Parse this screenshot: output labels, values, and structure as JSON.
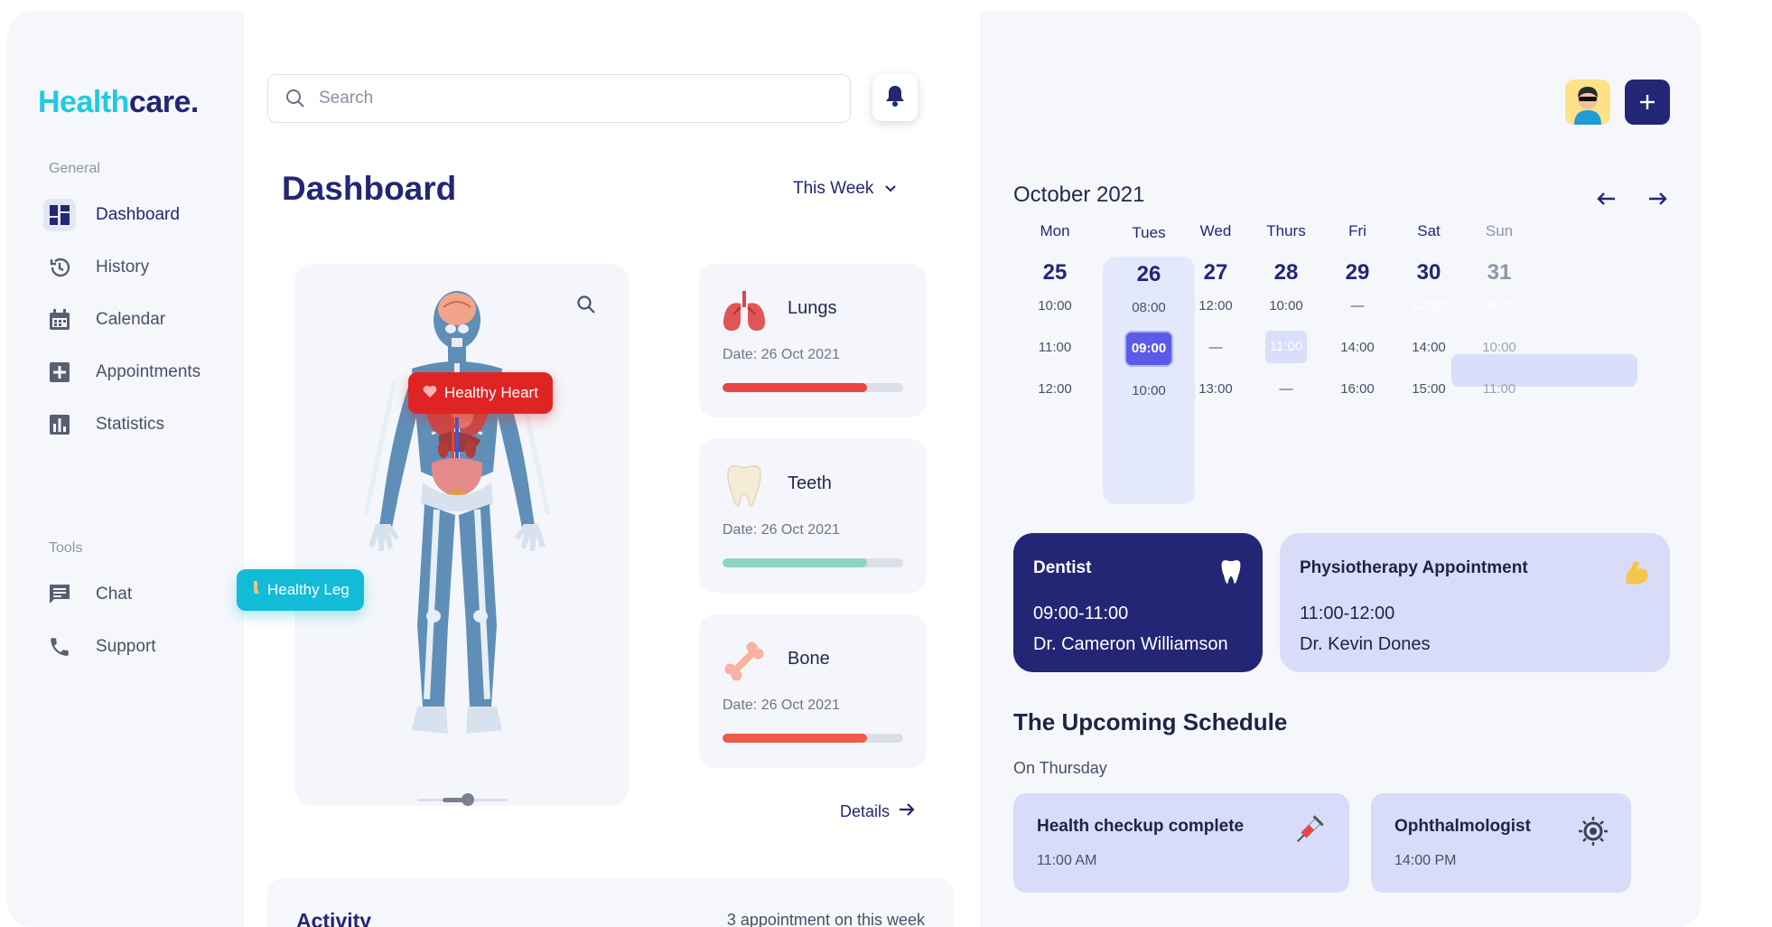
{
  "sidebar": {
    "logo_part1": "Health",
    "logo_part2": "care.",
    "general_label": "General",
    "tools_label": "Tools",
    "items": [
      {
        "label": "Dashboard"
      },
      {
        "label": "History"
      },
      {
        "label": "Calendar"
      },
      {
        "label": "Appointments"
      },
      {
        "label": "Statistics"
      },
      {
        "label": "Chat"
      },
      {
        "label": "Support"
      }
    ]
  },
  "header": {
    "search_placeholder": "Search"
  },
  "main": {
    "title": "Dashboard",
    "period": "This Week",
    "badges": {
      "heart": "Healthy Heart",
      "leg": "Healthy Leg"
    },
    "slider_value": 0.5,
    "organs": [
      {
        "name": "Lungs",
        "date": "Date: 26 Oct 2021",
        "progress": 0.8,
        "color": "#e84646"
      },
      {
        "name": "Teeth",
        "date": "Date: 26 Oct 2021",
        "progress": 0.8,
        "color": "#8fd3c3"
      },
      {
        "name": "Bone",
        "date": "Date: 26 Oct 2021",
        "progress": 0.8,
        "color": "#f05a4a"
      }
    ],
    "details_label": "Details",
    "activity": {
      "title": "Activity",
      "subtitle": "3 appointment on this week"
    }
  },
  "calendar": {
    "month": "October 2021",
    "days": [
      {
        "name": "Mon",
        "date": "25",
        "slots": [
          "10:00",
          "11:00",
          "12:00"
        ]
      },
      {
        "name": "Tues",
        "date": "26",
        "slots": [
          "08:00",
          "09:00",
          "10:00"
        ]
      },
      {
        "name": "Wed",
        "date": "27",
        "slots": [
          "12:00",
          "—",
          "13:00"
        ]
      },
      {
        "name": "Thurs",
        "date": "28",
        "slots": [
          "10:00",
          "11:00",
          "—"
        ]
      },
      {
        "name": "Fri",
        "date": "29",
        "slots": [
          "—",
          "14:00",
          "16:00"
        ]
      },
      {
        "name": "Sat",
        "date": "30",
        "slots": [
          "12:00",
          "14:00",
          "15:00"
        ]
      },
      {
        "name": "Sun",
        "date": "31",
        "slots": [
          "09:00",
          "10:00",
          "11:00"
        ]
      }
    ]
  },
  "appointments": [
    {
      "title": "Dentist",
      "time": "09:00-11:00",
      "doctor": "Dr. Cameron Williamson"
    },
    {
      "title": "Physiotherapy Appointment",
      "time": "11:00-12:00",
      "doctor": "Dr. Kevin Dones"
    }
  ],
  "upcoming": {
    "title": "The Upcoming Schedule",
    "subtitle": "On Thursday",
    "items": [
      {
        "title": "Health checkup complete",
        "time": "11:00 AM",
        "icon": "syringe-icon"
      },
      {
        "title": "Ophthalmologist",
        "time": "14:00 PM",
        "icon": "eye-icon"
      }
    ]
  },
  "colors": {
    "brand": "#232675",
    "accent": "#1ecbe1",
    "danger": "#e53935",
    "selected_slot": "#5b5be8"
  }
}
